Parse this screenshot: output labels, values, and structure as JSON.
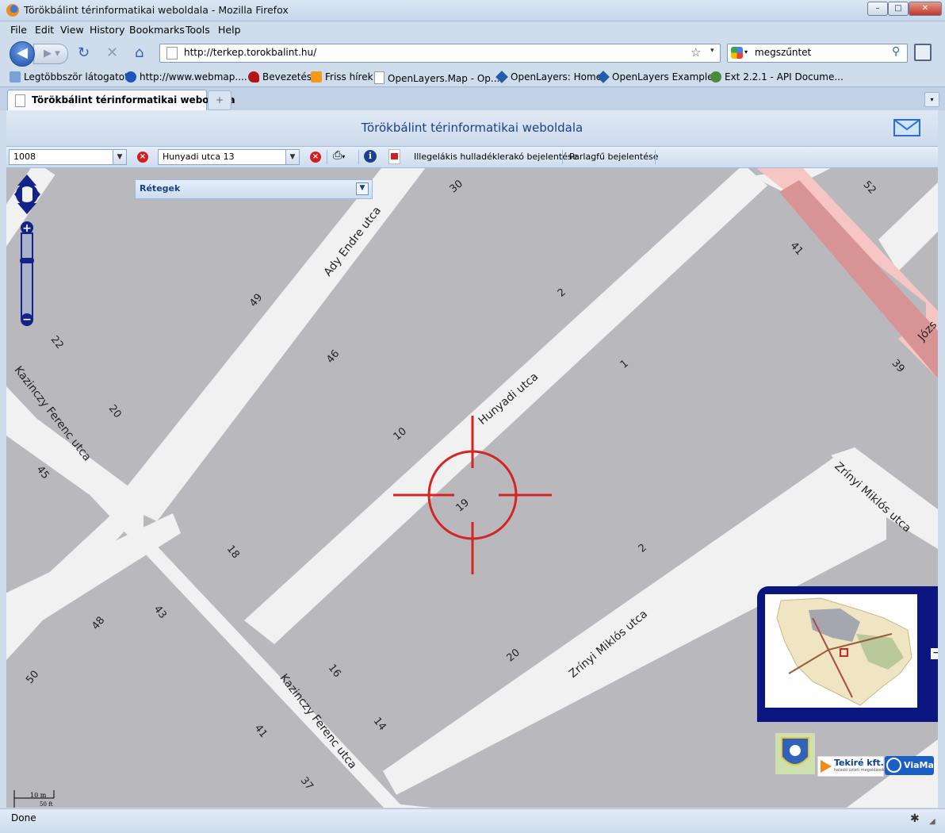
{
  "window": {
    "title": "Törökbálint térinformatikai weboldala - Mozilla Firefox",
    "min": "–",
    "max": "□",
    "close": "✕"
  },
  "menu": [
    "File",
    "Edit",
    "View",
    "History",
    "Bookmarks",
    "Tools",
    "Help"
  ],
  "nav": {
    "url": "http://terkep.torokbalint.hu/",
    "search_value": "megszűntet",
    "search_engine": "Google"
  },
  "bookmarks": [
    "Legtöbbször látogatott",
    "http://www.webmap....",
    "Bevezetés",
    "Friss hírek",
    "OpenLayers.Map - Op...",
    "OpenLayers: Home",
    "OpenLayers Examples",
    "Ext 2.2.1 - API Docume..."
  ],
  "tab": {
    "label": "Törökbálint térinformatikai weboldala",
    "new_tab": "+"
  },
  "page": {
    "title": "Törökbálint térinformatikai weboldala",
    "toolbar": {
      "combo1_value": "1008",
      "combo2_value": "Hunyadi utca 13",
      "report1": "Illegelákis hulladéklerakó bejelentése",
      "report2": "Parlagfű bejelentése"
    },
    "layers_panel_title": "Rétegek"
  },
  "map": {
    "streets": [
      "Ady Endre utca",
      "Hunyadi utca",
      "Kazinczy Ferenc utca",
      "Kazinczy Ferenc utca",
      "Zrínyi Miklós utca",
      "Zrínyi Miklós utca",
      "Józs"
    ],
    "house_numbers": [
      "30",
      "52",
      "41",
      "2",
      "49",
      "22",
      "46",
      "1",
      "39",
      "20",
      "10",
      "45",
      "19",
      "18",
      "2",
      "43",
      "48",
      "16",
      "20",
      "50",
      "14",
      "41",
      "37"
    ],
    "scale_top": "10 m",
    "scale_bottom": "50 ft",
    "logos": [
      "Tekiré kft.",
      "ViaMap"
    ],
    "logo_sub": "haladó üzleti megoldások",
    "overview_toggle": "−"
  },
  "status": "Done",
  "colors": {
    "road_fill": "#f2f1f1",
    "block_fill": "#b9b8bd",
    "rail_fill": "#f6c6c4",
    "crosshair": "#d42424",
    "accent": "#15428b"
  }
}
